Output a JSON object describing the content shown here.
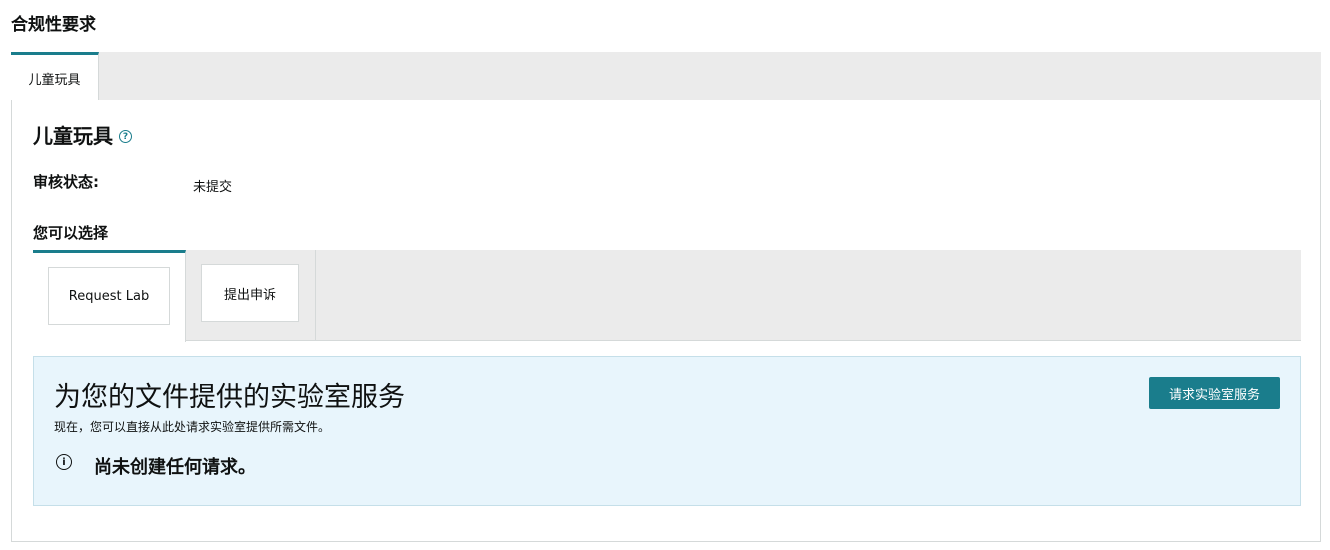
{
  "page": {
    "title": "合规性要求"
  },
  "tabs": [
    {
      "label": "儿童玩具"
    }
  ],
  "section": {
    "title": "儿童玩具",
    "help_icon": "question-circle-icon",
    "status_label": "审核状态:",
    "status_value": "未提交",
    "options_title": "您可以选择",
    "options": [
      {
        "label": "Request Lab"
      },
      {
        "label": "提出申诉"
      }
    ]
  },
  "lab_panel": {
    "heading": "为您的文件提供的实验室服务",
    "description": "现在，您可以直接从此处请求实验室提供所需文件。",
    "empty_message": "尚未创建任何请求。",
    "info_icon": "info-circle-icon",
    "button_label": "请求实验室服务"
  },
  "colors": {
    "accent": "#1a7d8c",
    "info_bg": "#e8f5fc",
    "tab_bg": "#ebebeb"
  }
}
